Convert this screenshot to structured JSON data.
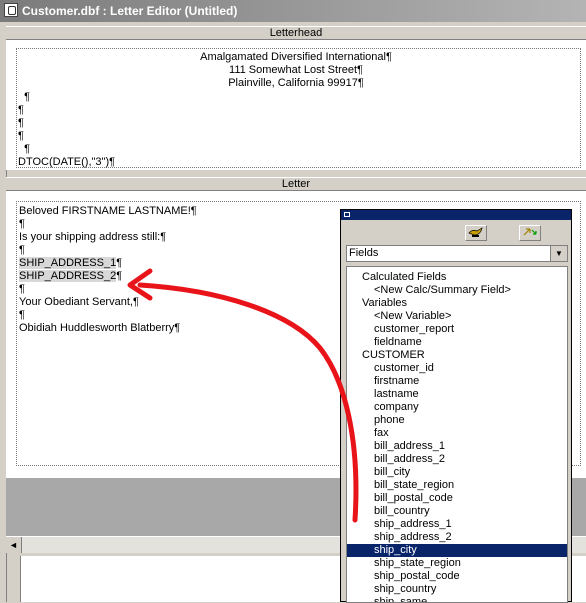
{
  "window": {
    "title": "Customer.dbf : Letter Editor (Untitled)"
  },
  "letterhead": {
    "header": "Letterhead",
    "lines_center": [
      "Amalgamated Diversified International¶",
      "111 Somewhat Lost Street¶",
      "Plainville, California 99917¶"
    ],
    "lines_left": [
      "  ¶",
      "¶",
      "¶",
      "¶",
      "  ¶",
      "DTOC(DATE(),\"3\")¶"
    ]
  },
  "letter": {
    "header": "Letter",
    "lines": [
      {
        "text": "Beloved FIRSTNAME LASTNAME!¶",
        "field": false
      },
      {
        "text": "¶",
        "field": false
      },
      {
        "text": "Is your shipping address still:¶",
        "field": false
      },
      {
        "text": "¶",
        "field": false
      },
      {
        "text": "SHIP_ADDRESS_1",
        "field": true,
        "suffix": "¶"
      },
      {
        "text": "SHIP_ADDRESS_2",
        "field": true,
        "suffix": "¶"
      },
      {
        "text": "¶",
        "field": false
      },
      {
        "text": "Your Obediant Servant,¶",
        "field": false
      },
      {
        "text": "¶",
        "field": false
      },
      {
        "text": "Obidiah Huddlesworth Blatberry¶",
        "field": false
      }
    ]
  },
  "fields_popup": {
    "combo_value": "Fields",
    "items": [
      {
        "text": "Calculated Fields",
        "indent": 1
      },
      {
        "text": "<New Calc/Summary Field>",
        "indent": 2
      },
      {
        "text": "Variables",
        "indent": 1
      },
      {
        "text": "<New Variable>",
        "indent": 2
      },
      {
        "text": "customer_report",
        "indent": 2
      },
      {
        "text": "fieldname",
        "indent": 2
      },
      {
        "text": "CUSTOMER",
        "indent": 1
      },
      {
        "text": "customer_id",
        "indent": 2
      },
      {
        "text": "firstname",
        "indent": 2
      },
      {
        "text": "lastname",
        "indent": 2
      },
      {
        "text": "company",
        "indent": 2
      },
      {
        "text": "phone",
        "indent": 2
      },
      {
        "text": "fax",
        "indent": 2
      },
      {
        "text": "bill_address_1",
        "indent": 2
      },
      {
        "text": "bill_address_2",
        "indent": 2
      },
      {
        "text": "bill_city",
        "indent": 2
      },
      {
        "text": "bill_state_region",
        "indent": 2
      },
      {
        "text": "bill_postal_code",
        "indent": 2
      },
      {
        "text": "bill_country",
        "indent": 2
      },
      {
        "text": "ship_address_1",
        "indent": 2
      },
      {
        "text": "ship_address_2",
        "indent": 2
      },
      {
        "text": "ship_city",
        "indent": 2,
        "selected": true
      },
      {
        "text": "ship_state_region",
        "indent": 2
      },
      {
        "text": "ship_postal_code",
        "indent": 2
      },
      {
        "text": "ship_country",
        "indent": 2
      },
      {
        "text": "ship_same",
        "indent": 2
      }
    ]
  },
  "colors": {
    "selection": "#0a246a",
    "annotation_arrow": "#e8141a"
  },
  "icons": {
    "toolbar_1": "lamp-icon",
    "toolbar_2": "link-icon"
  }
}
